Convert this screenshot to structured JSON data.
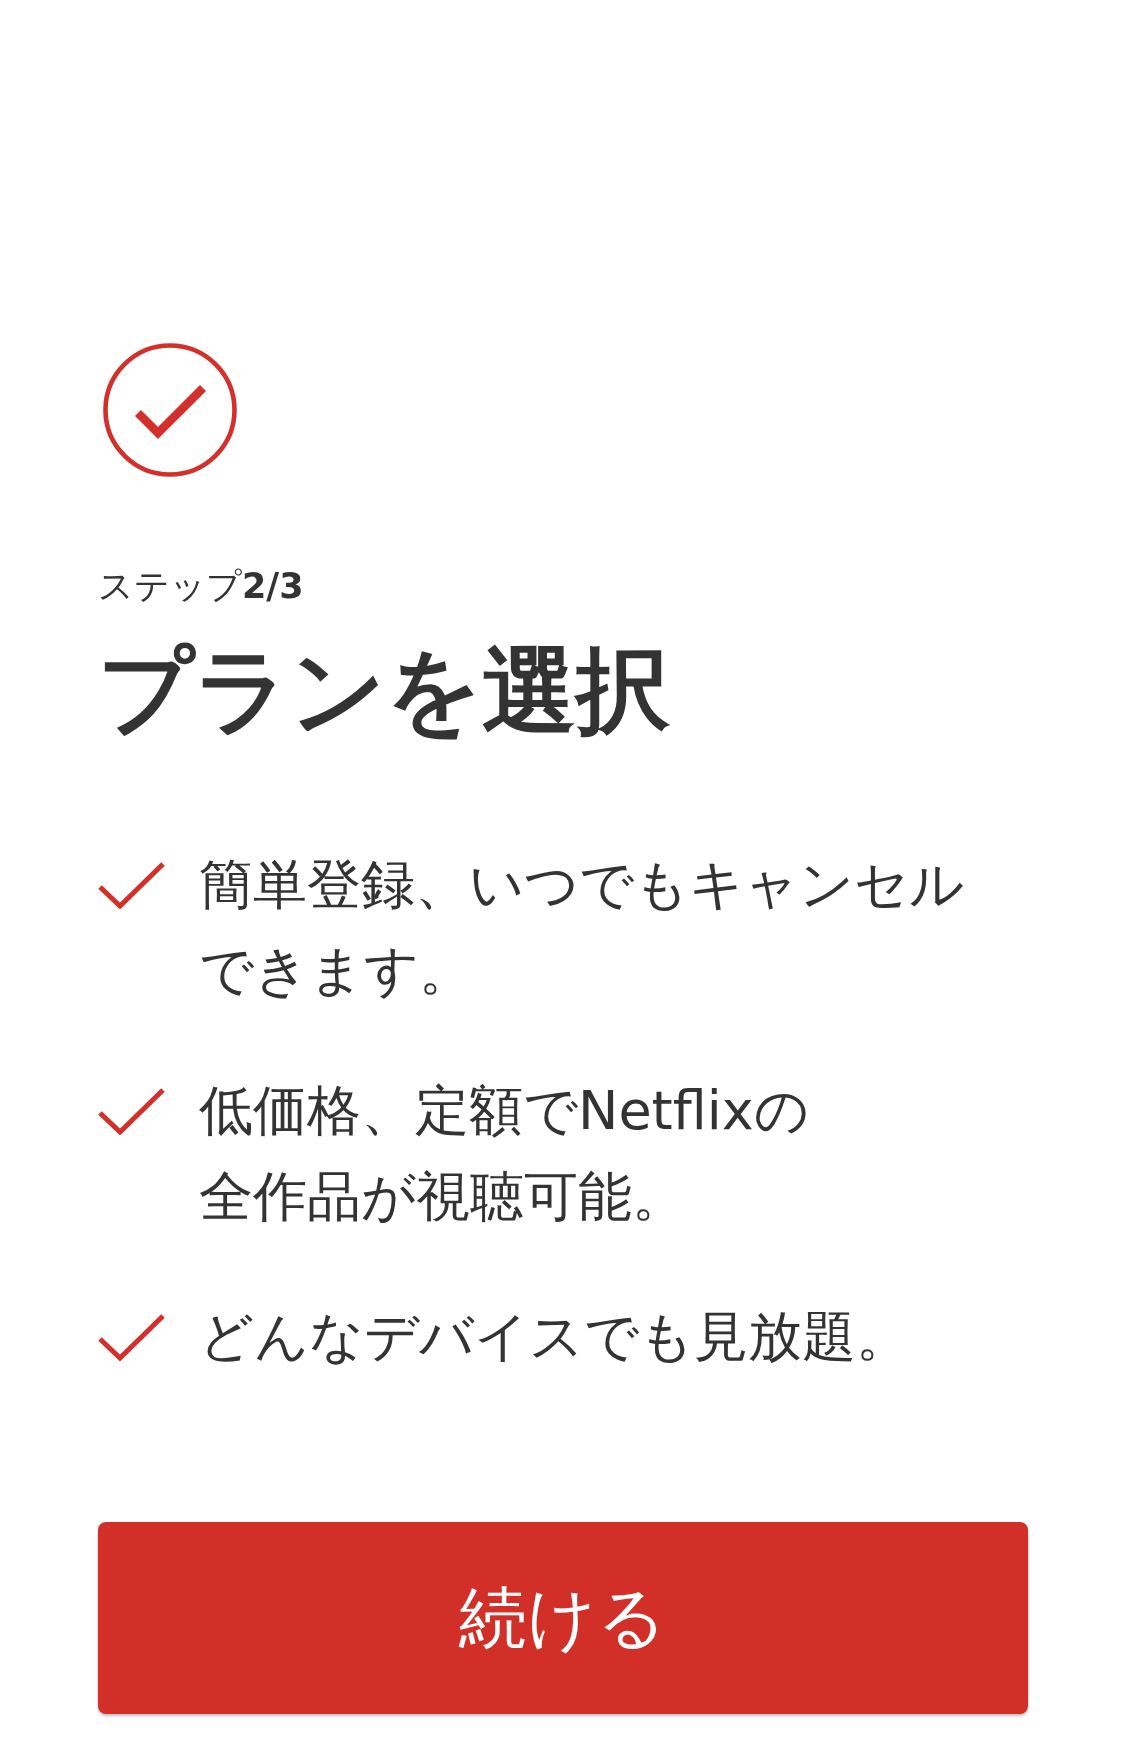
{
  "header": {
    "step_label": "ステップ**2/3**",
    "title": "プランを選択"
  },
  "benefits": [
    {
      "lines": [
        "簡単登録、いつでもキャンセル",
        "できます。"
      ]
    },
    {
      "lines": [
        "低価格、定額でNetflixの",
        "全作品が視聴可能。"
      ]
    },
    {
      "lines": [
        "どんなデバイスでも見放題。"
      ]
    }
  ],
  "continue_button": {
    "label": "続ける"
  }
}
